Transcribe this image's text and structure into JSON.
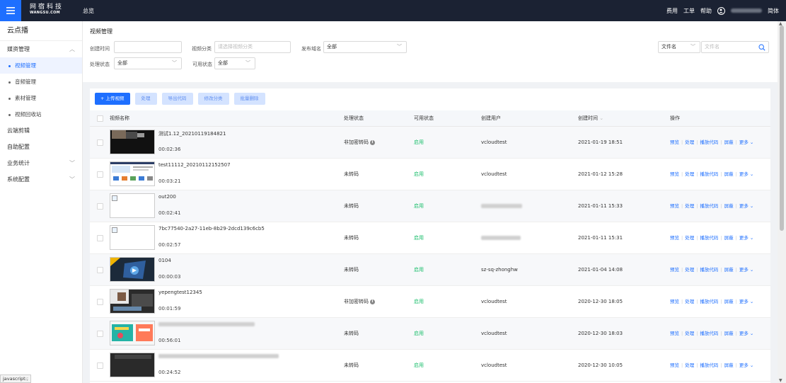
{
  "topbar": {
    "brand_cn": "网宿科技",
    "brand_en": "WANGSU.COM",
    "overview": "总览",
    "right_links": [
      "费用",
      "工单",
      "帮助"
    ],
    "lang": "简体"
  },
  "sidebar": {
    "title": "云点播",
    "groups": [
      {
        "label": "媒资管理",
        "expanded": true
      },
      {
        "label": "云端剪辑"
      },
      {
        "label": "自助配置"
      },
      {
        "label": "业务统计"
      },
      {
        "label": "系统配置"
      }
    ],
    "subs": [
      "视频管理",
      "音频管理",
      "素材管理",
      "视频回收站"
    ]
  },
  "status_hint": "javascript:;",
  "filters": {
    "page_title": "视频管理",
    "create_time_label": "创建时间",
    "category_label": "视频分类",
    "category_placeholder": "请选择视频分类",
    "domain_label": "发布域名",
    "domain_value": "全部",
    "process_label": "处理状态",
    "process_value": "全部",
    "available_label": "可用状态",
    "available_value": "全部",
    "search_field_value": "文件名",
    "search_placeholder": "文件名"
  },
  "toolbar": {
    "upload": "+ 上传视频",
    "process": "处理",
    "export": "导出代码",
    "modify": "修改分类",
    "delete": "批量删除"
  },
  "table": {
    "headers": {
      "name": "视频名称",
      "process": "处理状态",
      "available": "可用状态",
      "user": "创建用户",
      "time": "创建时间",
      "ops": "操作"
    },
    "ops": [
      "预览",
      "处理",
      "播放代码",
      "屏蔽",
      "更多"
    ],
    "rows": [
      {
        "name": "测试1.12_20210119184821",
        "duration": "00:02:36",
        "process": "非加密转码",
        "available": "启用",
        "user": "vcloudtest",
        "time": "2021-01-19 18:51"
      },
      {
        "name": "test11112_20210112152507",
        "duration": "00:03:21",
        "process": "未转码",
        "available": "启用",
        "user": "vcloudtest",
        "time": "2021-01-12 15:28"
      },
      {
        "name": "out200",
        "duration": "00:02:41",
        "process": "未转码",
        "available": "启用",
        "user": "",
        "time": "2021-01-11 15:33"
      },
      {
        "name": "7bc77540-2a27-11eb-8b29-2dcd139c6cb5",
        "duration": "00:02:57",
        "process": "未转码",
        "available": "启用",
        "user": "",
        "time": "2021-01-11 15:31"
      },
      {
        "name": "0104",
        "duration": "00:00:03",
        "process": "未转码",
        "available": "启用",
        "user": "sz-sq-zhonghw",
        "time": "2021-01-04 14:08"
      },
      {
        "name": "yepengtest12345",
        "duration": "00:01:59",
        "process": "非加密转码",
        "available": "启用",
        "user": "vcloudtest",
        "time": "2020-12-30 18:05"
      },
      {
        "name": "",
        "duration": "00:56:01",
        "process": "未转码",
        "available": "启用",
        "user": "vcloudtest",
        "time": "2020-12-30 18:03"
      },
      {
        "name": "",
        "duration": "00:24:52",
        "process": "未转码",
        "available": "启用",
        "user": "vcloudtest",
        "time": "2020-12-30 10:05"
      }
    ]
  }
}
